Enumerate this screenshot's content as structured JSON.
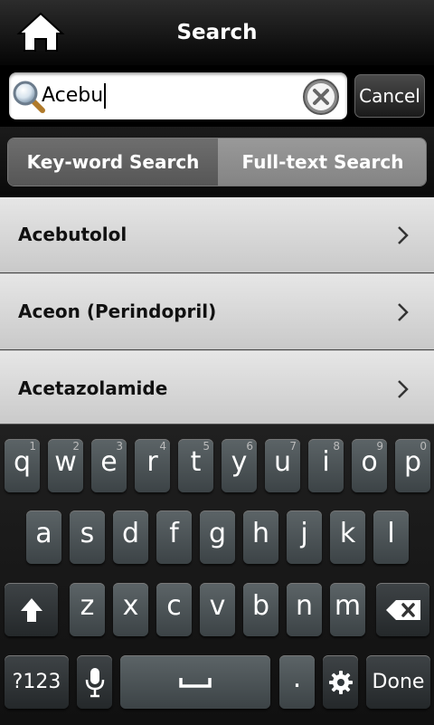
{
  "title": "Search",
  "search": {
    "value": "Acebu",
    "cancel_label": "Cancel"
  },
  "tabs": {
    "keyword": "Key-word Search",
    "fulltext": "Full-text Search"
  },
  "results": [
    "Acebutolol",
    "Aceon (Perindopril)",
    "Acetazolamide"
  ],
  "keyboard": {
    "row1": [
      {
        "k": "q",
        "n": "1"
      },
      {
        "k": "w",
        "n": "2"
      },
      {
        "k": "e",
        "n": "3"
      },
      {
        "k": "r",
        "n": "4"
      },
      {
        "k": "t",
        "n": "5"
      },
      {
        "k": "y",
        "n": "6"
      },
      {
        "k": "u",
        "n": "7"
      },
      {
        "k": "i",
        "n": "8"
      },
      {
        "k": "o",
        "n": "9"
      },
      {
        "k": "p",
        "n": "0"
      }
    ],
    "row2": [
      "a",
      "s",
      "d",
      "f",
      "g",
      "h",
      "j",
      "k",
      "l"
    ],
    "row3": [
      "z",
      "x",
      "c",
      "v",
      "b",
      "n",
      "m"
    ],
    "symbols_label": "?123",
    "period_label": ".",
    "done_label": "Done"
  }
}
